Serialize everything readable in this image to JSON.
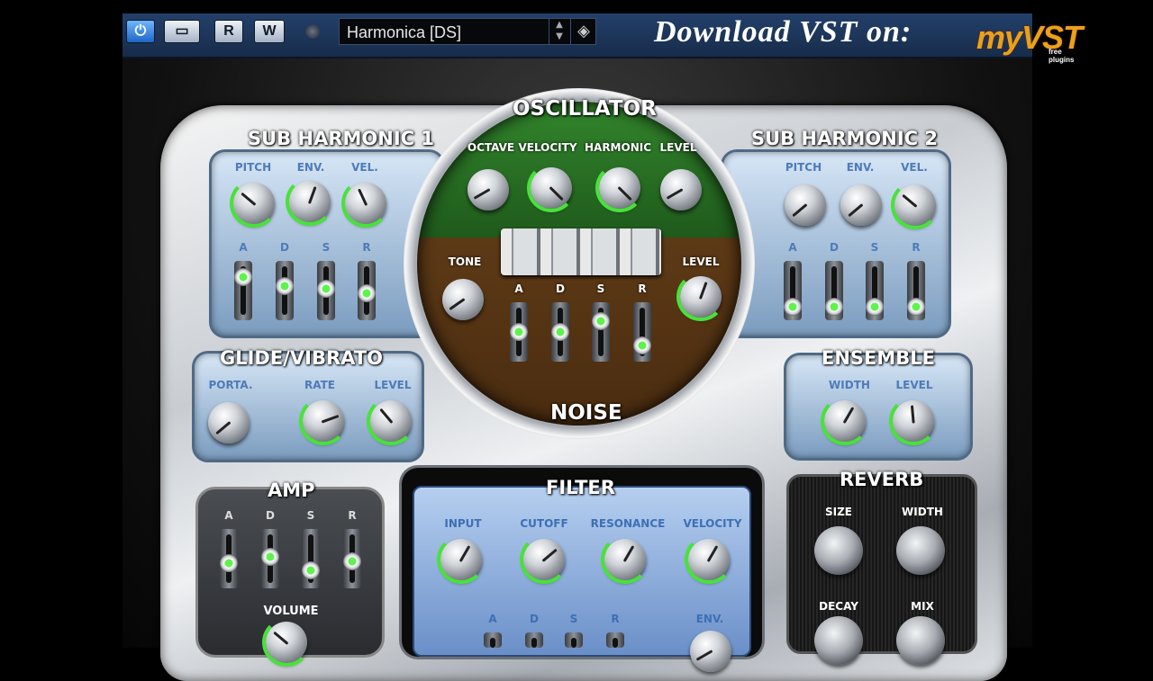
{
  "toolbar": {
    "power_label": "",
    "rack_label": "",
    "read_label": "R",
    "write_label": "W",
    "preset_name": "Harmonica [DS]"
  },
  "watermark": {
    "text": "Download VST on:",
    "brand": "myVST",
    "brand_sub": "free plugins"
  },
  "sections": {
    "sub1": {
      "title": "SUB HARMONIC 1",
      "knobs": [
        "PITCH",
        "ENV.",
        "VEL."
      ],
      "adsr": [
        "A",
        "D",
        "S",
        "R"
      ],
      "adsr_values": [
        0.8,
        0.6,
        0.55,
        0.45
      ]
    },
    "sub2": {
      "title": "SUB HARMONIC 2",
      "knobs": [
        "PITCH",
        "ENV.",
        "VEL."
      ],
      "adsr": [
        "A",
        "D",
        "S",
        "R"
      ],
      "adsr_values": [
        0.15,
        0.15,
        0.15,
        0.15
      ]
    },
    "osc": {
      "title": "OSCILLATOR",
      "knobs": [
        "OCTAVE",
        "VELOCITY",
        "HARMONIC",
        "LEVEL"
      ]
    },
    "noise": {
      "title": "NOISE",
      "tone": "TONE",
      "level": "LEVEL",
      "adsr": [
        "A",
        "D",
        "S",
        "R"
      ],
      "adsr_values": [
        0.5,
        0.5,
        0.75,
        0.2
      ]
    },
    "glide": {
      "title": "GLIDE/VIBRATO",
      "knobs": [
        "PORTA.",
        "RATE",
        "LEVEL"
      ]
    },
    "ensemble": {
      "title": "ENSEMBLE",
      "knobs": [
        "WIDTH",
        "LEVEL"
      ]
    },
    "amp": {
      "title": "AMP",
      "adsr": [
        "A",
        "D",
        "S",
        "R"
      ],
      "adsr_values": [
        0.4,
        0.55,
        0.25,
        0.45
      ],
      "volume": "VOLUME"
    },
    "filter": {
      "title": "FILTER",
      "knobs": [
        "INPUT",
        "CUTOFF",
        "RESONANCE",
        "VELOCITY"
      ],
      "adsr": [
        "A",
        "D",
        "S",
        "R"
      ],
      "env": "ENV."
    },
    "reverb": {
      "title": "REVERB",
      "knobs": [
        "SIZE",
        "WIDTH",
        "DECAY",
        "MIX"
      ]
    }
  },
  "colors": {
    "accent_green": "#48e23a",
    "panel_blue": "#7b9cbf",
    "toolbar": "#1f3a61"
  }
}
